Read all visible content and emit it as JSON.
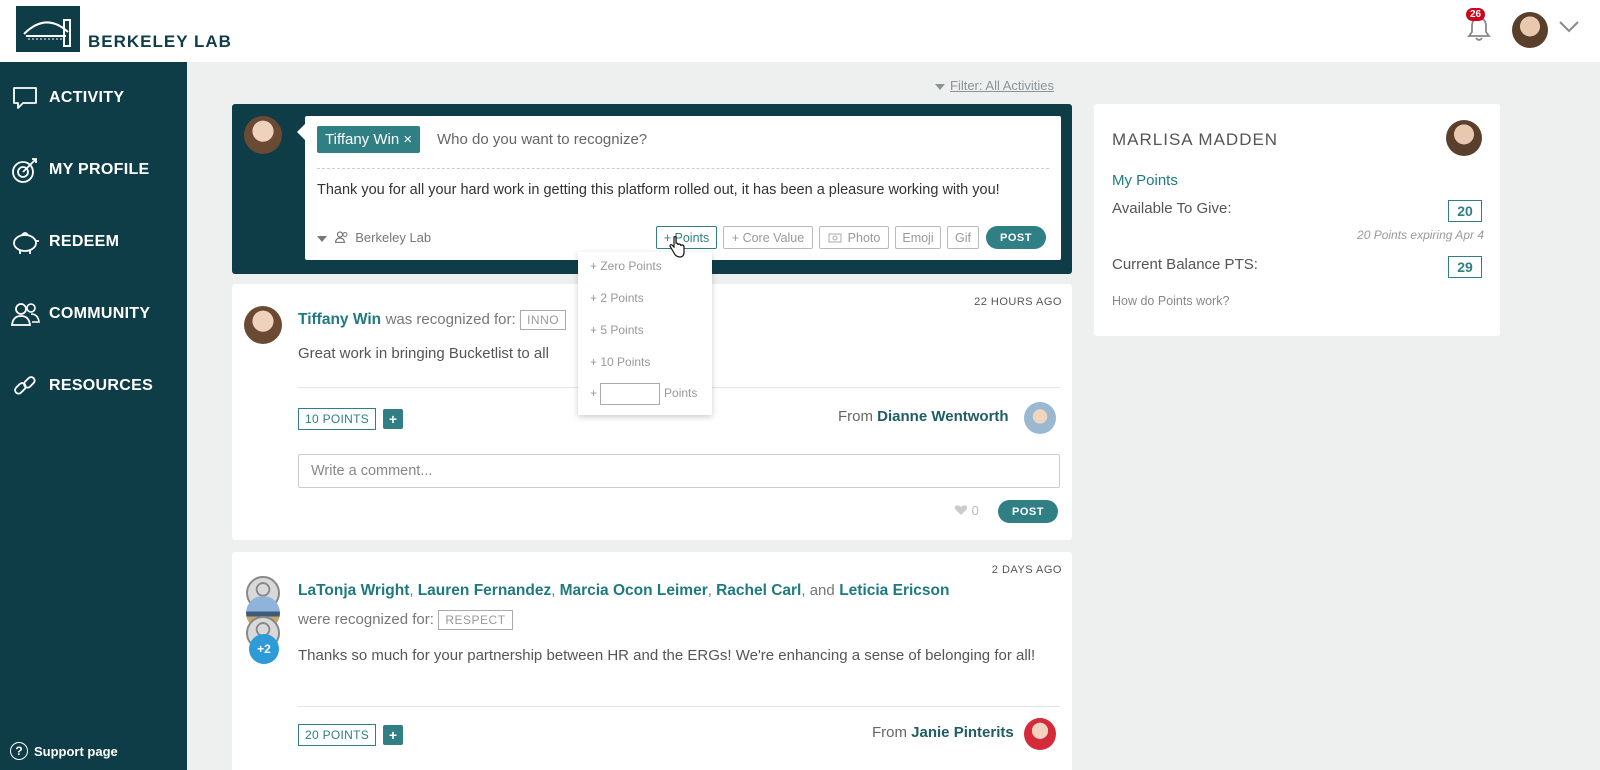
{
  "brand": {
    "name": "BERKELEY LAB"
  },
  "header": {
    "notification_count": "26"
  },
  "sidebar": {
    "items": [
      {
        "label": "ACTIVITY",
        "icon": "speech-bubble-icon"
      },
      {
        "label": "MY PROFILE",
        "icon": "target-icon"
      },
      {
        "label": "REDEEM",
        "icon": "piggy-bank-icon"
      },
      {
        "label": "COMMUNITY",
        "icon": "people-icon"
      },
      {
        "label": "RESOURCES",
        "icon": "link-icon"
      }
    ],
    "support_label": "Support page"
  },
  "filter": {
    "label": "Filter: All Activities"
  },
  "composer": {
    "recipient_chip": "Tiffany Win",
    "recipient_remove": "×",
    "placeholder": "Who do you want to recognize?",
    "message": "Thank you for all your hard work in getting this platform rolled out, it has been a pleasure working with you!",
    "audience": "Berkeley Lab",
    "buttons": {
      "points": "+ Points",
      "core_value": "+ Core Value",
      "photo": "Photo",
      "emoji": "Emoji",
      "gif": "Gif",
      "post": "POST"
    }
  },
  "points_dropdown": {
    "options": [
      "+ Zero Points",
      "+ 2 Points",
      "+ 5 Points",
      "+ 10 Points"
    ],
    "custom_prefix": "+",
    "custom_suffix": "Points"
  },
  "feed": [
    {
      "time": "22 HOURS AGO",
      "recipient": "Tiffany Win",
      "recognized_text": "was recognized for:",
      "value_tag": "INNO",
      "message": "Great work in bringing Bucketlist to all",
      "points": "10 POINTS",
      "plus": "+",
      "from_label": "From",
      "from_name": "Dianne Wentworth",
      "comment_placeholder": "Write a comment...",
      "likes": "0",
      "post": "POST"
    },
    {
      "time": "2 DAYS AGO",
      "recipients": [
        "LaTonja Wright",
        "Lauren Fernandez",
        "Marcia Ocon Leimer",
        "Rachel Carl"
      ],
      "last_recipient": "Leticia Ericson",
      "and": "and",
      "recognized_text": "were recognized for:",
      "value_tag": "RESPECT",
      "extra_avatars": "+2",
      "message": "Thanks so much for your partnership between HR and the ERGs! We're enhancing a sense of belonging for all!",
      "points": "20 POINTS",
      "plus": "+",
      "from_label": "From",
      "from_name": "Janie Pinterits"
    }
  ],
  "panel": {
    "name": "MARLISA MADDEN",
    "my_points": "My Points",
    "available_label": "Available To Give:",
    "available_value": "20",
    "expiring": "20 Points expiring Apr 4",
    "balance_label": "Current Balance PTS:",
    "balance_value": "29",
    "help_link": "How do Points work?"
  },
  "colors": {
    "brand": "#0f3d47",
    "accent": "#2f7f85",
    "badge": "#d0021b"
  }
}
